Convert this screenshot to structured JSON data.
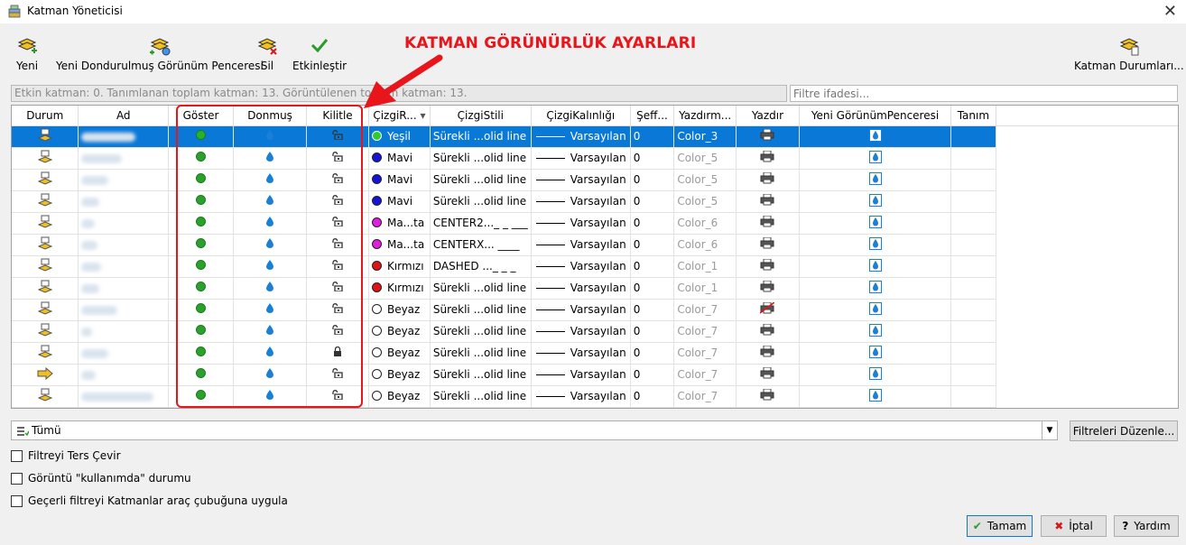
{
  "window": {
    "title": "Katman Yöneticisi"
  },
  "toolbar": {
    "new_label": "Yeni",
    "new_frozen_label": "Yeni Dondurulmuş Görünüm Penceresi",
    "delete_label": "Sil",
    "activate_label": "Etkinleştir",
    "states_label": "Katman Durumları..."
  },
  "annotation": {
    "text": "KATMAN GÖRÜNÜRLÜK AYARLARI",
    "color": "#e8151b"
  },
  "status_text": "Etkin katman: 0. Tanımlanan toplam katman: 13. Görüntülenen toplam katman: 13.",
  "filter_placeholder": "Filtre ifadesi...",
  "columns": [
    "Durum",
    "Ad",
    "Göster",
    "Donmuş",
    "Kilitle",
    "ÇizgiR...",
    "ÇizgiStili",
    "ÇizgiKalınlığı",
    "Şeff...",
    "Yazdırm...",
    "Yazdır",
    "Yeni GörünümPenceresi",
    "Tanım"
  ],
  "rows": [
    {
      "color_name": "Yeşil",
      "color": "#2ecc2e",
      "linetype": "Sürekli ...olid line",
      "lineweight": "Varsayılan",
      "transparency": "0",
      "plot_style": "Color_3",
      "locked": false,
      "selected": true
    },
    {
      "color_name": "Mavi",
      "color": "#1414d8",
      "linetype": "Sürekli ...olid line",
      "lineweight": "Varsayılan",
      "transparency": "0",
      "plot_style": "Color_5",
      "locked": false
    },
    {
      "color_name": "Mavi",
      "color": "#1414d8",
      "linetype": "Sürekli ...olid line",
      "lineweight": "Varsayılan",
      "transparency": "0",
      "plot_style": "Color_5",
      "locked": false
    },
    {
      "color_name": "Mavi",
      "color": "#1414d8",
      "linetype": "Sürekli ...olid line",
      "lineweight": "Varsayılan",
      "transparency": "0",
      "plot_style": "Color_5",
      "locked": false
    },
    {
      "color_name": "Ma...ta",
      "color": "#e01ee0",
      "linetype": "CENTER2..._ _ ___",
      "lineweight": "Varsayılan",
      "transparency": "0",
      "plot_style": "Color_6",
      "locked": false
    },
    {
      "color_name": "Ma...ta",
      "color": "#e01ee0",
      "linetype": "CENTERX... ____",
      "lineweight": "Varsayılan",
      "transparency": "0",
      "plot_style": "Color_6",
      "locked": false
    },
    {
      "color_name": "Kırmızı",
      "color": "#e01414",
      "linetype": "DASHED ..._ _ _",
      "lineweight": "Varsayılan",
      "transparency": "0",
      "plot_style": "Color_1",
      "locked": false
    },
    {
      "color_name": "Kırmızı",
      "color": "#e01414",
      "linetype": "Sürekli ...olid line",
      "lineweight": "Varsayılan",
      "transparency": "0",
      "plot_style": "Color_1",
      "locked": false
    },
    {
      "color_name": "Beyaz",
      "color": "#ffffff",
      "linetype": "Sürekli ...olid line",
      "lineweight": "Varsayılan",
      "transparency": "0",
      "plot_style": "Color_7",
      "locked": false,
      "no_plot": true
    },
    {
      "color_name": "Beyaz",
      "color": "#ffffff",
      "linetype": "Sürekli ...olid line",
      "lineweight": "Varsayılan",
      "transparency": "0",
      "plot_style": "Color_7",
      "locked": false
    },
    {
      "color_name": "Beyaz",
      "color": "#ffffff",
      "linetype": "Sürekli ...olid line",
      "lineweight": "Varsayılan",
      "transparency": "0",
      "plot_style": "Color_7",
      "locked": true
    },
    {
      "color_name": "Beyaz",
      "color": "#ffffff",
      "linetype": "Sürekli ...olid line",
      "lineweight": "Varsayılan",
      "transparency": "0",
      "plot_style": "Color_7",
      "locked": false,
      "current": true
    },
    {
      "color_name": "Beyaz",
      "color": "#ffffff",
      "linetype": "Sürekli ...olid line",
      "lineweight": "Varsayılan",
      "transparency": "0",
      "plot_style": "Color_7",
      "locked": false
    }
  ],
  "filter_combo": {
    "value": "Tümü"
  },
  "edit_filters_label": "Filtreleri Düzenle...",
  "checkboxes": {
    "invert": "Filtreyi Ters Çevir",
    "in_use": "Görüntü \"kullanımda\" durumu",
    "apply_toolbar": "Geçerli filtreyi Katmanlar araç çubuğuna uygula"
  },
  "buttons": {
    "ok": "Tamam",
    "cancel": "İptal",
    "help": "Yardım"
  }
}
